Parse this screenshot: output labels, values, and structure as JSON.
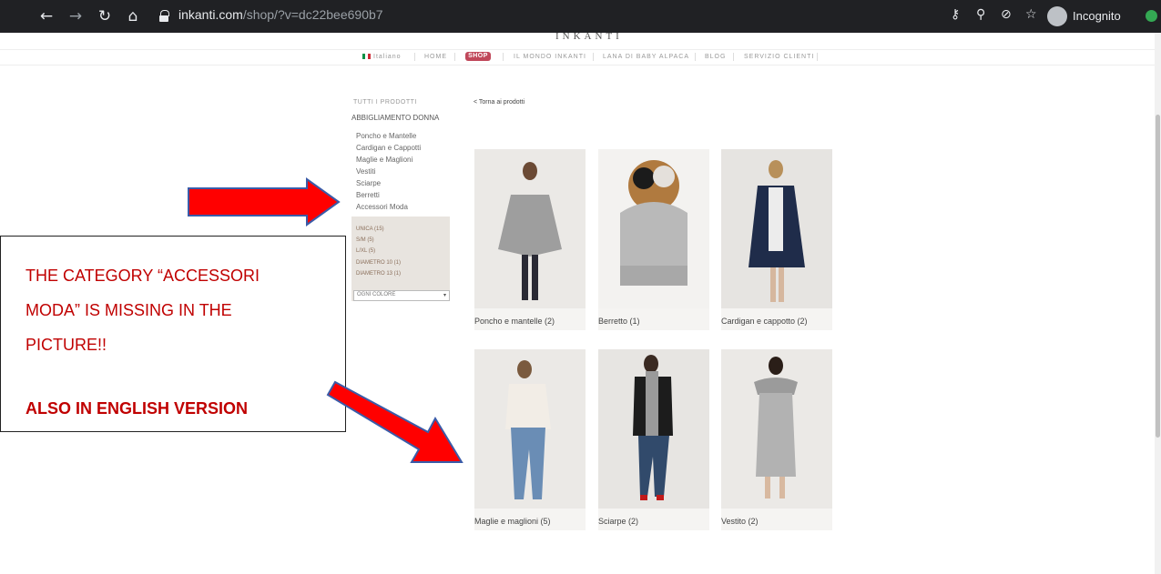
{
  "browser": {
    "url_host": "inkanti.com",
    "url_path": "/shop/?v=dc22bee690b7",
    "incognito_label": "Incognito",
    "nav_icons": [
      "back-icon",
      "forward-icon",
      "reload-icon",
      "home-icon"
    ],
    "right_icons": [
      "key-icon",
      "zoom-icon",
      "eye-off-icon",
      "star-icon"
    ]
  },
  "site": {
    "logo": "INKANTI",
    "nav": {
      "language": "Italiano",
      "home": "HOME",
      "shop": "SHOP",
      "mondo": "IL MONDO INKANTI",
      "lana": "LANA DI BABY ALPACA",
      "blog": "BLOG",
      "servizio": "SERVIZIO CLIENTI"
    }
  },
  "sidebar": {
    "all_products": "TUTTI I PRODOTTI",
    "category": "ABBIGLIAMENTO DONNA",
    "subcategories": [
      "Poncho e Mantelle",
      "Cardigan e Cappotti",
      "Maglie e Maglioni",
      "Vestiti",
      "Sciarpe",
      "Berretti",
      "Accessori Moda"
    ],
    "sizes": [
      "UNICA (15)",
      "S/M (5)",
      "L/XL (5)",
      "DIAMETRO 10 (1)",
      "DIAMETRO 13 (1)"
    ],
    "color_select": "OGNI COLORE"
  },
  "back_link": "< Torna ai prodotti",
  "products": [
    {
      "label": "Poncho e mantelle (2)"
    },
    {
      "label": "Berretto (1)"
    },
    {
      "label": "Cardigan e cappotto (2)"
    },
    {
      "label": "Maglie e maglioni (5)"
    },
    {
      "label": "Sciarpe (2)"
    },
    {
      "label": "Vestito (2)"
    }
  ],
  "annotation": {
    "lines": [
      "THE CATEGORY “ACCESSORI",
      "MODA” IS MISSING IN THE",
      "PICTURE!!"
    ],
    "bold_line": "ALSO IN ENGLISH VERSION",
    "arrow_color": "#ff0000"
  },
  "colors": {
    "browser_bar": "#202124",
    "shop_badge": "#c0475a",
    "filter_bg": "#e8e4df",
    "note_text": "#c00000"
  }
}
